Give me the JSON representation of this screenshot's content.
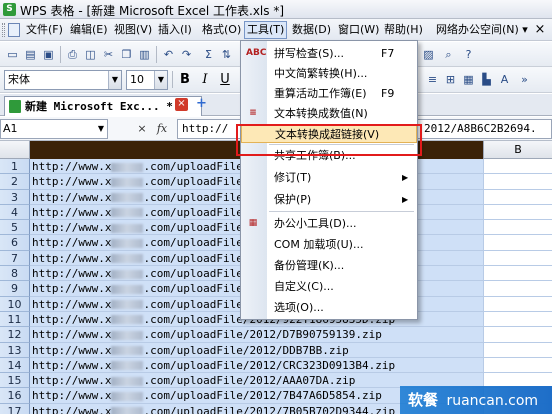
{
  "window": {
    "title": "WPS 表格 - [新建 Microsoft Excel 工作表.xls *]"
  },
  "menubar": {
    "items": [
      "文件(F)",
      "编辑(E)",
      "视图(V)",
      "插入(I)",
      "格式(O)",
      "工具(T)",
      "数据(D)",
      "窗口(W)",
      "帮助(H)",
      "网络办公空间(N) ▾"
    ],
    "active_index": 5
  },
  "toolbar": {
    "font_name": "宋体",
    "font_size": "10",
    "bold": "B",
    "italic": "I",
    "underline": "U"
  },
  "doc_tab": {
    "label": "新建 Microsoft Exc... *"
  },
  "formula_bar": {
    "cell_ref": "A1",
    "cancel_glyph": "×",
    "fx_glyph": "fx",
    "value_head": "http://",
    "value_tail": "2012/A8B6C2B2694."
  },
  "grid": {
    "column_b": "B",
    "rows": [
      {
        "num": "1",
        "url_prefix": "http://www.x",
        "url_suffix": ".com/uploadFile/"
      },
      {
        "num": "2",
        "url_prefix": "http://www.x",
        "url_suffix": ".com/uploadFile/"
      },
      {
        "num": "3",
        "url_prefix": "http://www.x",
        "url_suffix": ".com/uploadFile/"
      },
      {
        "num": "4",
        "url_prefix": "http://www.x",
        "url_suffix": ".com/uploadFile/"
      },
      {
        "num": "5",
        "url_prefix": "http://www.x",
        "url_suffix": ".com/uploadFile/"
      },
      {
        "num": "6",
        "url_prefix": "http://www.x",
        "url_suffix": ".com/uploadFile/"
      },
      {
        "num": "7",
        "url_prefix": "http://www.x",
        "url_suffix": ".com/uploadFile/"
      },
      {
        "num": "8",
        "url_prefix": "http://www.x",
        "url_suffix": ".com/uploadFile/"
      },
      {
        "num": "9",
        "url_prefix": "http://www.x",
        "url_suffix": ".com/uploadFile/"
      },
      {
        "num": "10",
        "url_prefix": "http://www.x",
        "url_suffix": ".com/uploadFile/"
      },
      {
        "num": "11",
        "url_prefix": "http://www.x",
        "url_suffix": ".com/uploadFile/2012/922T18695835D.zip"
      },
      {
        "num": "12",
        "url_prefix": "http://www.x",
        "url_suffix": ".com/uploadFile/2012/D7B90759139.zip"
      },
      {
        "num": "13",
        "url_prefix": "http://www.x",
        "url_suffix": ".com/uploadFile/2012/DDB7BB.zip"
      },
      {
        "num": "14",
        "url_prefix": "http://www.x",
        "url_suffix": ".com/uploadFile/2012/CRC323D0913B4.zip"
      },
      {
        "num": "15",
        "url_prefix": "http://www.x",
        "url_suffix": ".com/uploadFile/2012/AAA07DA.zip"
      },
      {
        "num": "16",
        "url_prefix": "http://www.x",
        "url_suffix": ".com/uploadFile/2012/7B47A6D5854.zip"
      },
      {
        "num": "17",
        "url_prefix": "http://www.x",
        "url_suffix": ".com/uploadFile/2012/7B05B702D9344.zip"
      }
    ]
  },
  "tools_menu": {
    "items": [
      {
        "label": "拼写检查(S)...",
        "shortcut": "F7",
        "icon": "ABC"
      },
      {
        "label": "中文简繁转换(H)..."
      },
      {
        "label": "重算活动工作簿(E)",
        "shortcut": "F9"
      },
      {
        "label": "文本转换成数值(N)",
        "icon": "≡"
      },
      {
        "label": "文本转换成超链接(V)",
        "highlighted": true
      },
      {
        "label": "共享工作簿(B)..."
      },
      {
        "label": "修订(T)",
        "submenu": true
      },
      {
        "label": "保护(P)",
        "submenu": true
      },
      {
        "label": "办公小工具(D)...",
        "icon": "▦"
      },
      {
        "label": "COM 加载项(U)..."
      },
      {
        "label": "备份管理(K)..."
      },
      {
        "label": "自定义(C)..."
      },
      {
        "label": "选项(O)..."
      }
    ]
  },
  "watermark": {
    "cn": "软餐",
    "en": "ruancan.com"
  },
  "colors": {
    "accent_highlight": "#fde8b6",
    "annotation_red": "#e21b1b",
    "selection": "#cfe0f7"
  }
}
